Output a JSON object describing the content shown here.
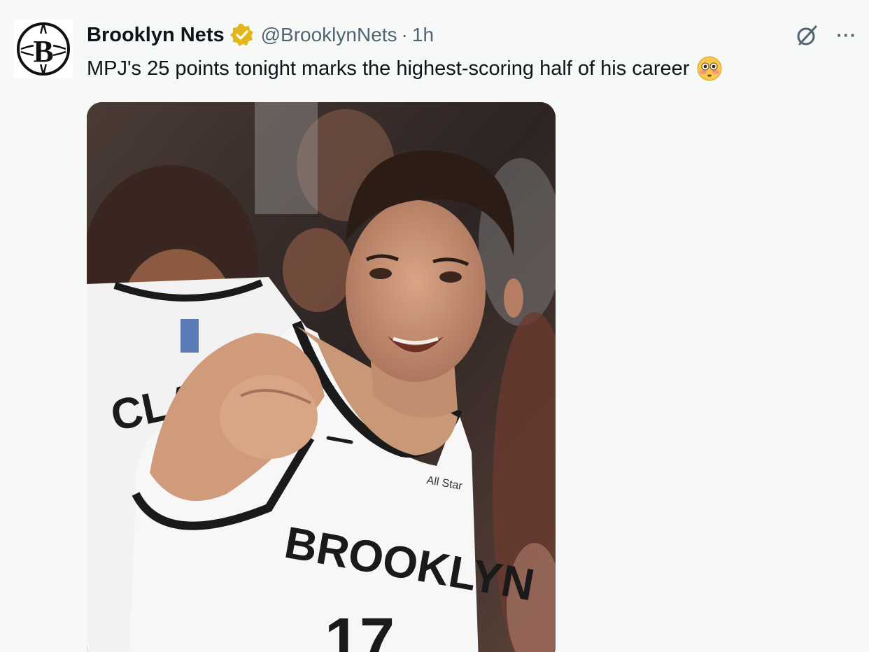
{
  "tweet": {
    "display_name": "Brooklyn Nets",
    "handle": "@BrooklynNets",
    "separator": "·",
    "time": "1h",
    "text": "MPJ's 25 points tonight marks the highest-scoring half of his career",
    "emoji_name": "flushed-face-emoji",
    "verified_badge_color": "#e2b719",
    "more_label": "···"
  },
  "avatar": {
    "letter": "B"
  },
  "media": {
    "jersey_wordmark": "BROOKLYN",
    "jersey_number": "17",
    "back_player_lettering": "CLA",
    "jersey_tag": "All Star"
  },
  "colors": {
    "background": "#f7f9f9",
    "text_primary": "#0f1419",
    "text_secondary": "#536471"
  }
}
